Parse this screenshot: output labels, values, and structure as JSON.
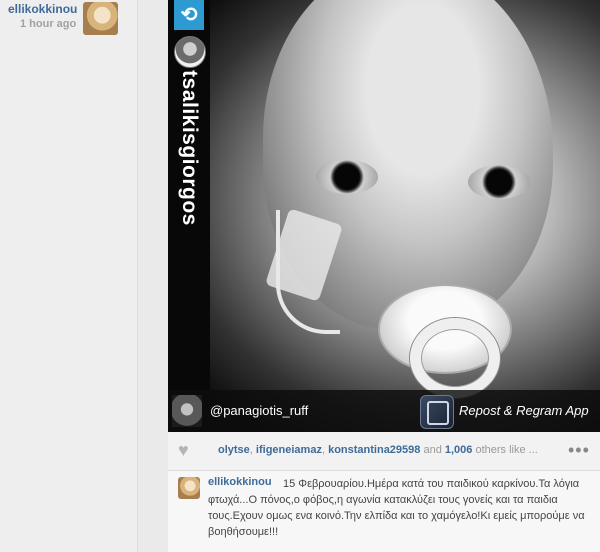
{
  "sidebar": {
    "username": "ellikokkinou",
    "timestamp": "1 hour ago"
  },
  "photo": {
    "repost_icon": "repost-icon",
    "original_user": "tsalikisgiorgos",
    "credit_user": "@panagiotis_ruff",
    "app_name": "Repost & Regram App"
  },
  "likes": {
    "user1": "olytse",
    "sep1": ", ",
    "user2": "ifigeneiamaz",
    "sep2": ", ",
    "user3": "konstantina29598",
    "and": " and ",
    "count": "1,006",
    "others": " others like ..."
  },
  "caption": {
    "username": "ellikokkinou",
    "text": "15 Φεβρουαρίου.Ημέρα κατά του παιδικού καρκίνου.Τα λόγια φτωχά...Ο πόνος,ο φόβος,η αγωνία κατακλύζει τους γονείς και τα παιδια τους.Εχουν ομως ενα κοινό.Την ελπίδα και το χαμόγελο!Κι εμείς μπορούμε να βοηθήσουμε!!!"
  }
}
